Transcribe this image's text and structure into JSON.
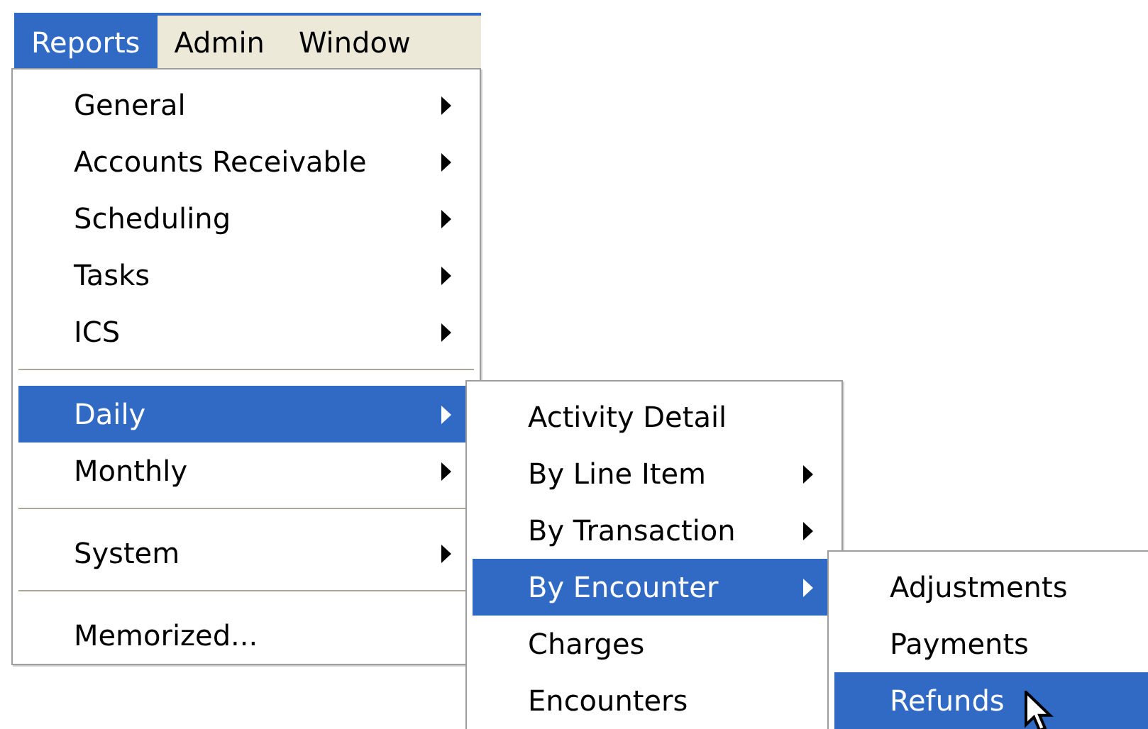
{
  "menubar": [
    {
      "label": "Reports",
      "selected": true
    },
    {
      "label": "Admin",
      "selected": false
    },
    {
      "label": "Window",
      "selected": false
    }
  ],
  "menus": [
    {
      "items": [
        {
          "kind": "item",
          "label": "General",
          "submenu": true,
          "selected": false
        },
        {
          "kind": "item",
          "label": "Accounts Receivable",
          "submenu": true,
          "selected": false
        },
        {
          "kind": "item",
          "label": "Scheduling",
          "submenu": true,
          "selected": false
        },
        {
          "kind": "item",
          "label": "Tasks",
          "submenu": true,
          "selected": false
        },
        {
          "kind": "item",
          "label": "ICS",
          "submenu": true,
          "selected": false
        },
        {
          "kind": "separator"
        },
        {
          "kind": "item",
          "label": "Daily",
          "submenu": true,
          "selected": true
        },
        {
          "kind": "item",
          "label": "Monthly",
          "submenu": true,
          "selected": false
        },
        {
          "kind": "separator"
        },
        {
          "kind": "item",
          "label": "System",
          "submenu": true,
          "selected": false
        },
        {
          "kind": "separator"
        },
        {
          "kind": "item",
          "label": "Memorized...",
          "submenu": false,
          "selected": false
        }
      ]
    },
    {
      "items": [
        {
          "kind": "item",
          "label": "Activity Detail",
          "submenu": false,
          "selected": false
        },
        {
          "kind": "item",
          "label": "By Line Item",
          "submenu": true,
          "selected": false
        },
        {
          "kind": "item",
          "label": "By Transaction",
          "submenu": true,
          "selected": false
        },
        {
          "kind": "item",
          "label": "By Encounter",
          "submenu": true,
          "selected": true
        },
        {
          "kind": "item",
          "label": "Charges",
          "submenu": false,
          "selected": false
        },
        {
          "kind": "item",
          "label": "Encounters",
          "submenu": false,
          "selected": false
        }
      ]
    },
    {
      "items": [
        {
          "kind": "item",
          "label": "Adjustments",
          "submenu": false,
          "selected": false
        },
        {
          "kind": "item",
          "label": "Payments",
          "submenu": false,
          "selected": false
        },
        {
          "kind": "item",
          "label": "Refunds",
          "submenu": false,
          "selected": true
        }
      ]
    }
  ]
}
